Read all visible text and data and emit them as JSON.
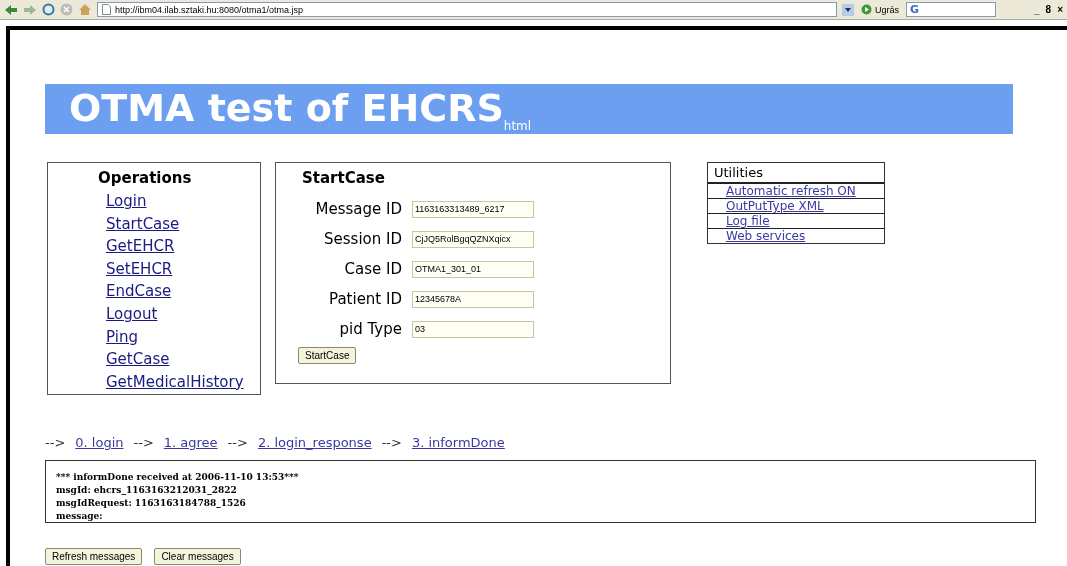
{
  "browser": {
    "url": "http://ibm04.ilab.sztaki.hu:8080/otma1/otma.jsp",
    "go_label": "Ugrás",
    "search_label": "G",
    "window_controls": [
      "_",
      "8",
      "×"
    ]
  },
  "banner": {
    "title": "OTMA test of EHCRS$_{html}$"
  },
  "operations": {
    "title": "Operations",
    "items": [
      "Login",
      "StartCase",
      "GetEHCR",
      "SetEHCR",
      "EndCase",
      "Logout",
      "Ping",
      "GetCase",
      "GetMedicalHistory"
    ]
  },
  "form": {
    "title": "StartCase",
    "fields": [
      {
        "label": "Message ID",
        "value": "1163163313489_6217"
      },
      {
        "label": "Session ID",
        "value": "CjJQ5RolBgqQZNXqicx"
      },
      {
        "label": "Case ID",
        "value": "OTMA1_301_01"
      },
      {
        "label": "Patient ID",
        "value": "12345678A"
      },
      {
        "label": "pid Type",
        "value": "03"
      }
    ],
    "button": "StartCase"
  },
  "utilities": {
    "title": "Utilities",
    "items": [
      "Automatic refresh ON",
      "OutPutType XML",
      "Log file",
      "Web services"
    ]
  },
  "flow": {
    "separator": "-->",
    "steps": [
      "0. login",
      "1. agree",
      "2. login_response",
      "3. informDone"
    ]
  },
  "messages": [
    "*** informDone received at 2006-11-10 13:53***",
    "msgId: ehcrs_1163163212031_2822",
    "msgIdRequest: 1163163184788_1526",
    "message:"
  ],
  "buttons": [
    "Refresh messages",
    "Clear messages"
  ]
}
